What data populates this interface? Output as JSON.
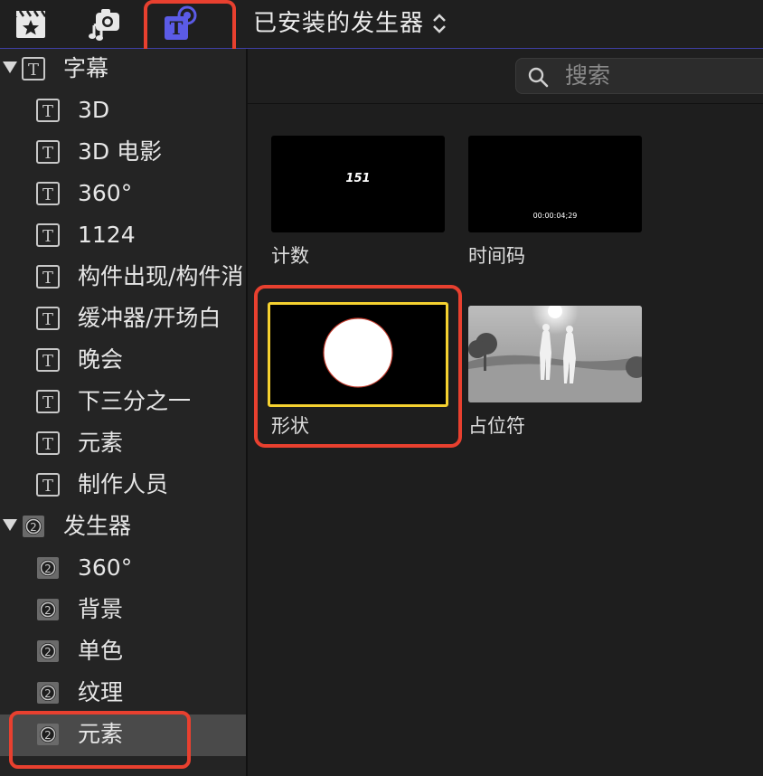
{
  "toolbar": {
    "library_icons": [
      "clapper-star-icon",
      "camera-music-icon",
      "titles-generators-icon"
    ],
    "title": "已安装的发生器",
    "accent": "#5b5be6",
    "highlight_color": "#e8402f"
  },
  "sidebar": {
    "titles_section": {
      "label": "字幕",
      "items": [
        "3D",
        "3D 电影",
        "360°",
        "1124",
        "构件出现/构件消",
        "缓冲器/开场白",
        "晚会",
        "下三分之一",
        "元素",
        "制作人员"
      ]
    },
    "generators_section": {
      "label": "发生器",
      "items": [
        "360°",
        "背景",
        "单色",
        "纹理",
        "元素"
      ],
      "selected": "元素"
    }
  },
  "search": {
    "placeholder": "搜索"
  },
  "browser": {
    "tiles": [
      {
        "label": "计数",
        "thumb_text": "151"
      },
      {
        "label": "时间码",
        "thumb_text": "00:00:04;29"
      },
      {
        "label": "形状",
        "selected": true,
        "selection_color": "#f5d130"
      },
      {
        "label": "占位符"
      }
    ]
  }
}
